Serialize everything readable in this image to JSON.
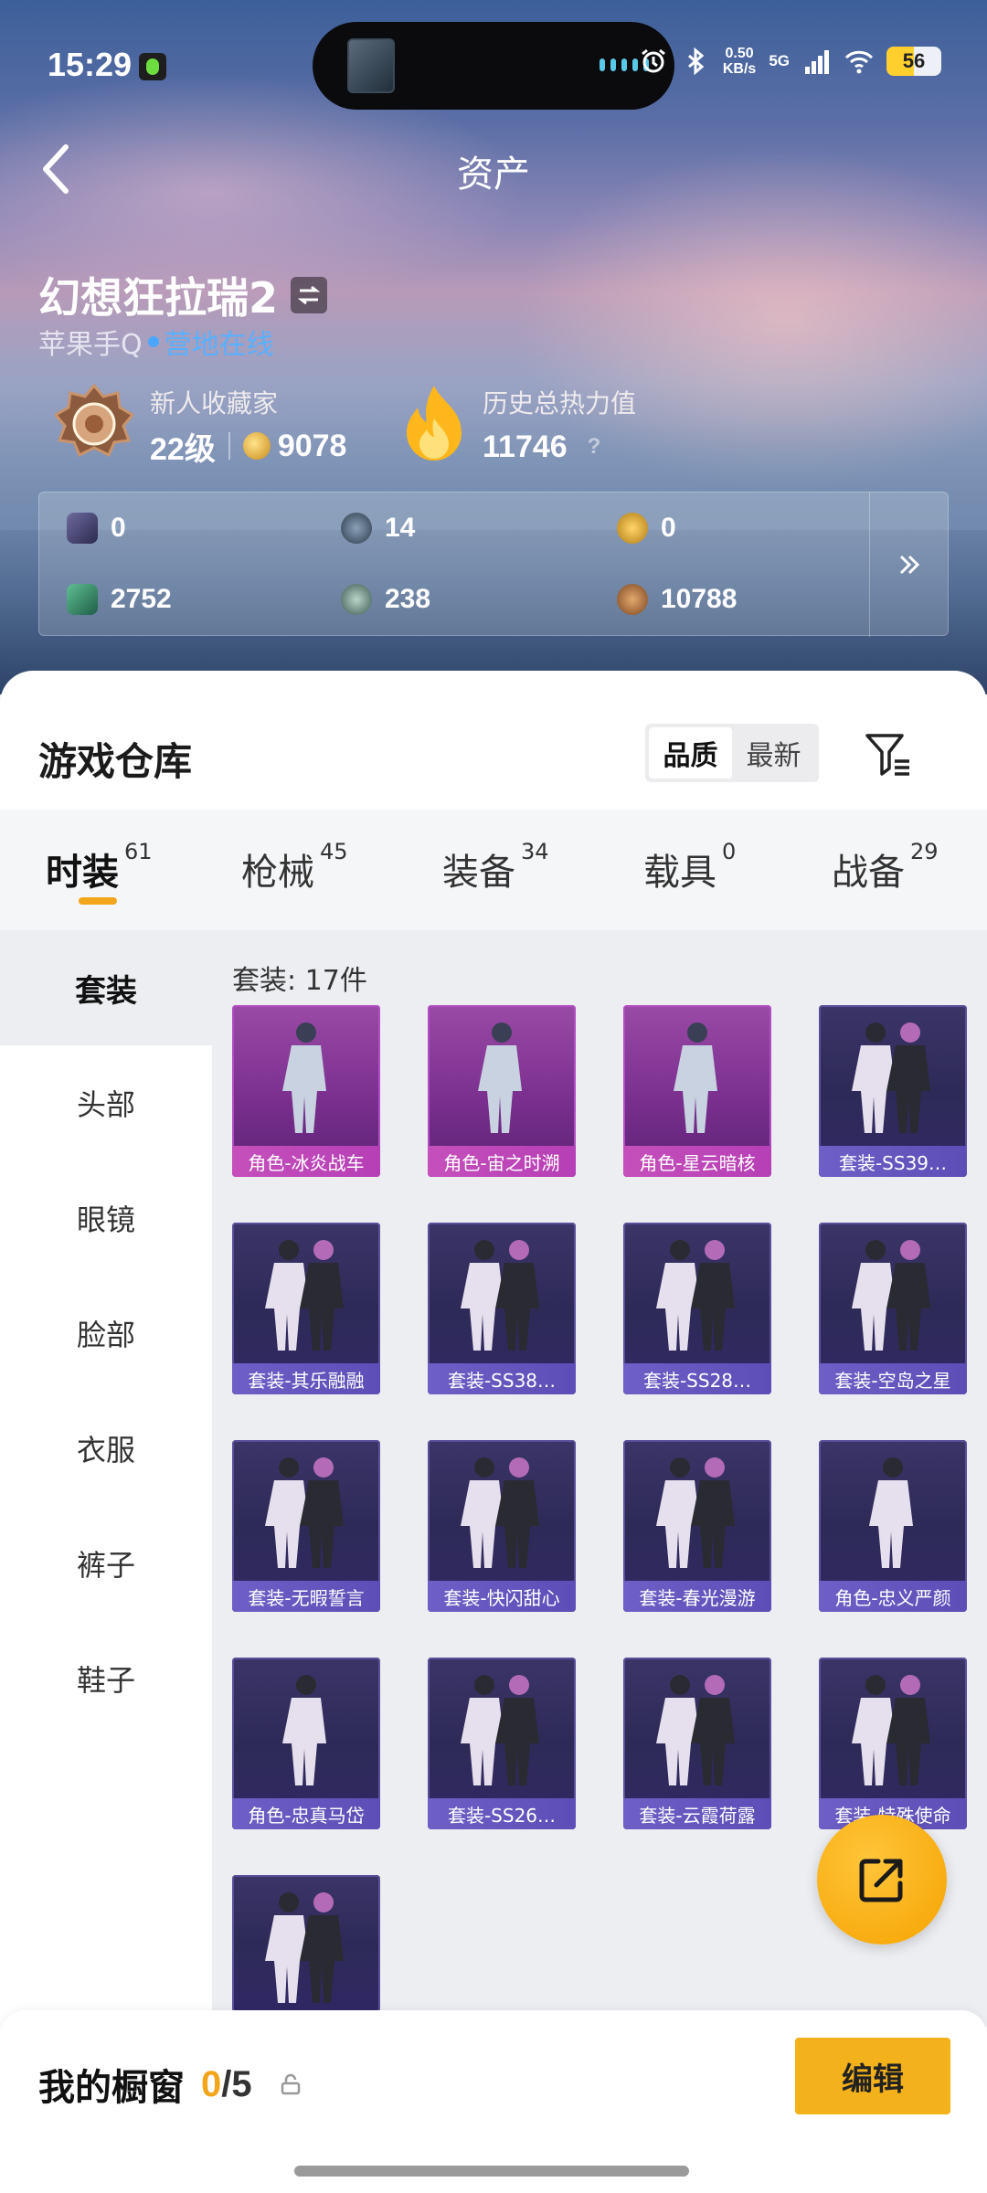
{
  "status_bar": {
    "time": "15:29",
    "speed_value": "0.50",
    "speed_unit": "KB/s",
    "network": "5G",
    "battery": "56"
  },
  "header": {
    "title": "资产"
  },
  "profile": {
    "name": "幻想狂拉瑞2",
    "platform": "苹果手Q",
    "online_status": "营地在线",
    "rank_title": "新人收藏家",
    "level": "22级",
    "collection_points": "9078",
    "heat_label": "历史总热力值",
    "heat_value": "11746",
    "heat_help": "?"
  },
  "currencies": [
    {
      "icon": "card-icon",
      "value": "0"
    },
    {
      "icon": "token-icon",
      "value": "14"
    },
    {
      "icon": "gold-token-icon",
      "value": "0"
    },
    {
      "icon": "voucher-icon",
      "value": "2752"
    },
    {
      "icon": "orb-icon",
      "value": "238"
    },
    {
      "icon": "bronze-coin-icon",
      "value": "10788"
    }
  ],
  "warehouse": {
    "title": "游戏仓库",
    "sort": {
      "quality": "品质",
      "newest": "最新",
      "selected": "品质"
    },
    "tabs": [
      {
        "label": "时装",
        "count": "61",
        "active": true
      },
      {
        "label": "枪械",
        "count": "45"
      },
      {
        "label": "装备",
        "count": "34"
      },
      {
        "label": "载具",
        "count": "0"
      },
      {
        "label": "战备",
        "count": "29"
      }
    ],
    "sidebar": [
      {
        "label": "套装",
        "active": true
      },
      {
        "label": "头部"
      },
      {
        "label": "眼镜"
      },
      {
        "label": "脸部"
      },
      {
        "label": "衣服"
      },
      {
        "label": "裤子"
      },
      {
        "label": "鞋子"
      }
    ],
    "set_count": "套装: 17件",
    "items": [
      {
        "name": "角色-冰炎战车",
        "rarity": "pink"
      },
      {
        "name": "角色-宙之时溯",
        "rarity": "pink"
      },
      {
        "name": "角色-星云暗核",
        "rarity": "pink"
      },
      {
        "name": "套装-SS39…",
        "rarity": "purple"
      },
      {
        "name": "套装-其乐融融",
        "rarity": "purple"
      },
      {
        "name": "套装-SS38…",
        "rarity": "purple"
      },
      {
        "name": "套装-SS28…",
        "rarity": "purple"
      },
      {
        "name": "套装-空岛之星",
        "rarity": "purple"
      },
      {
        "name": "套装-无暇誓言",
        "rarity": "purple"
      },
      {
        "name": "套装-快闪甜心",
        "rarity": "purple"
      },
      {
        "name": "套装-春光漫游",
        "rarity": "purple"
      },
      {
        "name": "角色-忠义严颜",
        "rarity": "purple"
      },
      {
        "name": "角色-忠真马岱",
        "rarity": "purple"
      },
      {
        "name": "套装-SS26…",
        "rarity": "purple"
      },
      {
        "name": "套装-云霞荷露",
        "rarity": "purple"
      },
      {
        "name": "套装-特殊使命",
        "rarity": "purple"
      },
      {
        "name": "",
        "rarity": "purple"
      }
    ]
  },
  "showcase": {
    "label": "我的橱窗",
    "current": "0",
    "max": "/5",
    "edit": "编辑"
  },
  "colors": {
    "accent": "#f3b11c",
    "pink_rarity": "#b63fb6",
    "purple_rarity": "#5c4eb6",
    "online": "#58b0ff"
  }
}
